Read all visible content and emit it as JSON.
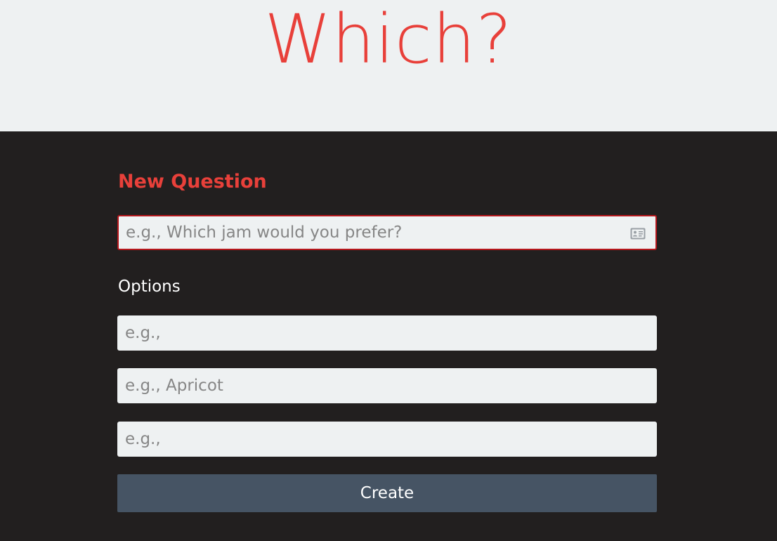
{
  "header": {
    "title": "Which?"
  },
  "form": {
    "title": "New Question",
    "question": {
      "value": "",
      "placeholder": "e.g., Which jam would you prefer?",
      "icon": "contact-card-icon"
    },
    "options_label": "Options",
    "options": [
      {
        "value": "",
        "placeholder": "e.g.,"
      },
      {
        "value": "",
        "placeholder": "e.g., Apricot"
      },
      {
        "value": "",
        "placeholder": "e.g.,"
      }
    ],
    "submit_label": "Create"
  },
  "colors": {
    "accent": "#e8403a",
    "header_bg": "#eef1f2",
    "main_bg": "#221f1f",
    "input_bg": "#eef1f2",
    "input_border_error": "#b6171c",
    "button_bg": "#465464"
  }
}
